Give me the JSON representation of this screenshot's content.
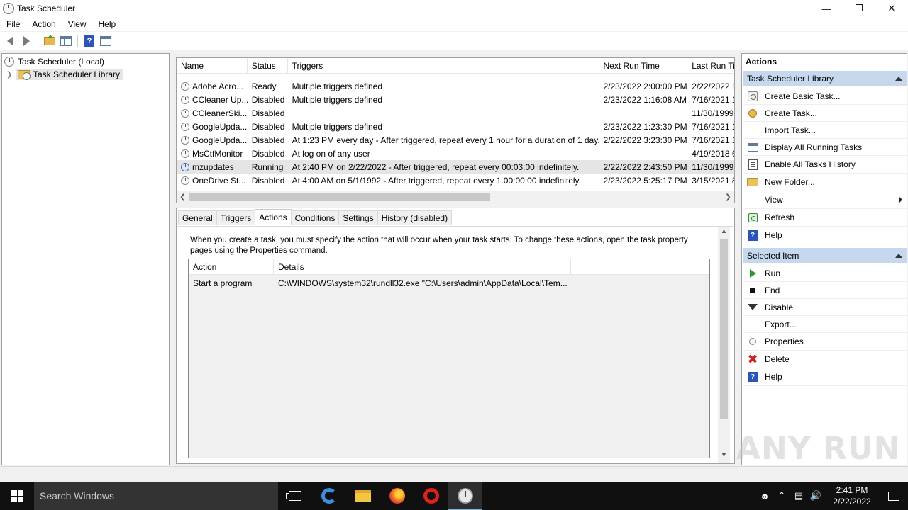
{
  "window": {
    "title": "Task Scheduler",
    "controls": {
      "minimize": "—",
      "restore": "❐",
      "close": "✕"
    }
  },
  "menu": [
    "File",
    "Action",
    "View",
    "Help"
  ],
  "tree": {
    "root": "Task Scheduler (Local)",
    "library": "Task Scheduler Library"
  },
  "task_list": {
    "columns": [
      "Name",
      "Status",
      "Triggers",
      "Next Run Time",
      "Last Run Ti"
    ],
    "rows": [
      {
        "name": "Adobe Acro...",
        "status": "Ready",
        "triggers": "Multiple triggers defined",
        "next": "2/23/2022 2:00:00 PM",
        "last": "2/22/2022 1",
        "running": false
      },
      {
        "name": "CCleaner Up...",
        "status": "Disabled",
        "triggers": "Multiple triggers defined",
        "next": "2/23/2022 1:16:08 AM",
        "last": "7/16/2021 1",
        "running": false
      },
      {
        "name": "CCleanerSki...",
        "status": "Disabled",
        "triggers": "",
        "next": "",
        "last": "11/30/1999",
        "running": false
      },
      {
        "name": "GoogleUpda...",
        "status": "Disabled",
        "triggers": "Multiple triggers defined",
        "next": "2/23/2022 1:23:30 PM",
        "last": "7/16/2021 1",
        "running": false
      },
      {
        "name": "GoogleUpda...",
        "status": "Disabled",
        "triggers": "At 1:23 PM every day - After triggered, repeat every 1 hour for a duration of 1 day.",
        "next": "2/22/2022 3:23:30 PM",
        "last": "7/16/2021 1",
        "running": false
      },
      {
        "name": "MsCtfMonitor",
        "status": "Disabled",
        "triggers": "At log on of any user",
        "next": "",
        "last": "4/19/2018 6",
        "running": false
      },
      {
        "name": "mzupdates",
        "status": "Running",
        "triggers": "At 2:40 PM on 2/22/2022 - After triggered, repeat every 00:03:00 indefinitely.",
        "next": "2/22/2022 2:43:50 PM",
        "last": "11/30/1999",
        "running": true
      },
      {
        "name": "OneDrive St...",
        "status": "Disabled",
        "triggers": "At 4:00 AM on 5/1/1992 - After triggered, repeat every 1.00:00:00 indefinitely.",
        "next": "2/23/2022 5:25:17 PM",
        "last": "3/15/2021 8",
        "running": false
      }
    ]
  },
  "details": {
    "tabs": [
      "General",
      "Triggers",
      "Actions",
      "Conditions",
      "Settings",
      "History (disabled)"
    ],
    "active_tab": "Actions",
    "description": "When you create a task, you must specify the action that will occur when your task starts.  To change these actions, open the task property pages using the Properties command.",
    "columns": [
      "Action",
      "Details"
    ],
    "rows": [
      {
        "action": "Start a program",
        "details": "C:\\WINDOWS\\system32\\rundll32.exe \"C:\\Users\\admin\\AppData\\Local\\Tem..."
      }
    ]
  },
  "actions_pane": {
    "title": "Actions",
    "section1": {
      "title": "Task Scheduler Library",
      "items": [
        {
          "label": "Create Basic Task...",
          "icon": "create-basic-task-icon"
        },
        {
          "label": "Create Task...",
          "icon": "create-task-icon"
        },
        {
          "label": "Import Task...",
          "icon": ""
        },
        {
          "label": "Display All Running Tasks",
          "icon": "display-running-icon"
        },
        {
          "label": "Enable All Tasks History",
          "icon": "history-icon"
        },
        {
          "label": "New Folder...",
          "icon": "folder-icon"
        },
        {
          "label": "View",
          "icon": ""
        },
        {
          "label": "Refresh",
          "icon": "refresh-icon"
        },
        {
          "label": "Help",
          "icon": "help-icon"
        }
      ]
    },
    "section2": {
      "title": "Selected Item",
      "items": [
        {
          "label": "Run",
          "icon": "run-icon"
        },
        {
          "label": "End",
          "icon": "end-icon"
        },
        {
          "label": "Disable",
          "icon": "disable-icon"
        },
        {
          "label": "Export...",
          "icon": ""
        },
        {
          "label": "Properties",
          "icon": "properties-icon"
        },
        {
          "label": "Delete",
          "icon": "delete-icon"
        },
        {
          "label": "Help",
          "icon": "help-icon"
        }
      ]
    }
  },
  "taskbar": {
    "search_placeholder": "Search Windows",
    "time": "2:41 PM",
    "date": "2/22/2022"
  },
  "watermark": "ANY RUN"
}
